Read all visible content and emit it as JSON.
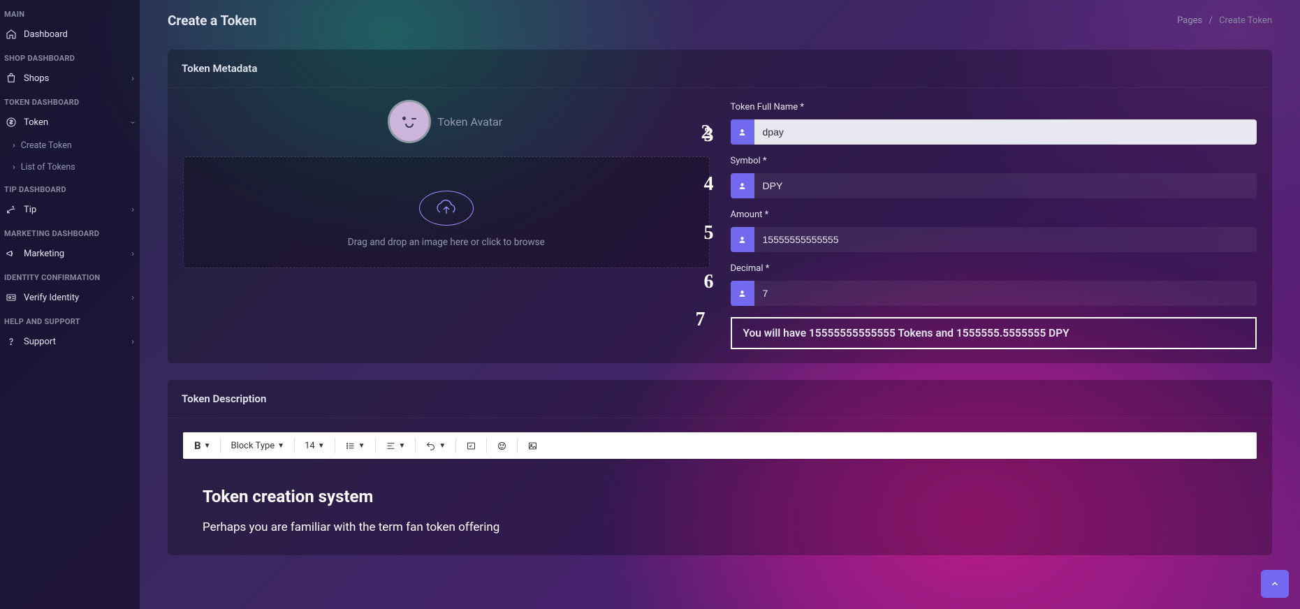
{
  "sidebar": {
    "sections": [
      {
        "title": "MAIN",
        "items": [
          {
            "icon": "home",
            "label": "Dashboard",
            "chev": false
          }
        ]
      },
      {
        "title": "SHOP DASHBOARD",
        "items": [
          {
            "icon": "bag",
            "label": "Shops",
            "chev": true
          }
        ]
      },
      {
        "title": "TOKEN DASHBOARD",
        "items": [
          {
            "icon": "dollar",
            "label": "Token",
            "chev": true,
            "open": true,
            "sub": [
              "Create Token",
              "List of Tokens"
            ]
          }
        ]
      },
      {
        "title": "TIP DASHBOARD",
        "items": [
          {
            "icon": "tip",
            "label": "Tip",
            "chev": true
          }
        ]
      },
      {
        "title": "MARKETING DASHBOARD",
        "items": [
          {
            "icon": "megaphone",
            "label": "Marketing",
            "chev": true
          }
        ]
      },
      {
        "title": "IDENTITY CONFIRMATION",
        "items": [
          {
            "icon": "idcard",
            "label": "Verify Identity",
            "chev": true
          }
        ]
      },
      {
        "title": "HELP AND SUPPORT",
        "items": [
          {
            "icon": "question",
            "label": "Support",
            "chev": true
          }
        ]
      }
    ]
  },
  "header": {
    "title": "Create a Token",
    "crumb_root": "Pages",
    "crumb_current": "Create Token"
  },
  "metadata_card": {
    "title": "Token Metadata",
    "avatar_label": "Token Avatar",
    "drop_text": "Drag and drop an image here or click to browse",
    "fields": {
      "name_label": "Token Full Name *",
      "name_value": "dpay",
      "symbol_label": "Symbol *",
      "symbol_value": "DPY",
      "amount_label": "Amount *",
      "amount_value": "15555555555555",
      "decimal_label": "Decimal *",
      "decimal_value": "7"
    },
    "summary": "You will have 15555555555555 Tokens and 1555555.5555555 DPY",
    "annotations": {
      "a2": "2",
      "a3": "3",
      "a4": "4",
      "a5": "5",
      "a6": "6",
      "a7": "7"
    }
  },
  "description_card": {
    "title": "Token Description",
    "toolbar": {
      "blocktype": "Block Type",
      "fontsize": "14"
    },
    "content_heading": "Token creation system",
    "content_para": "Perhaps you are familiar with the term fan token offering"
  }
}
